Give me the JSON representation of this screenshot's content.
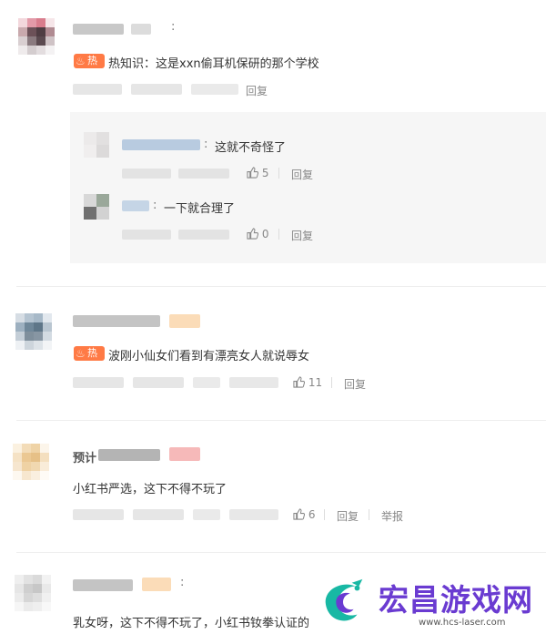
{
  "colors": {
    "hot_badge": "#ff7a45",
    "text": "#333333",
    "muted": "#888888",
    "reply_bg": "#f6f6f6",
    "brand": "#6a3bd1"
  },
  "badge_label": "热",
  "comments": [
    {
      "hot": true,
      "text": "热知识：这是xxn偷耳机保研的那个学校",
      "reply_label": "回复",
      "replies": [
        {
          "text": "这就不奇怪了",
          "likes": "5",
          "reply_label": "回复"
        },
        {
          "text": "一下就合理了",
          "likes": "0",
          "reply_label": "回复"
        }
      ]
    },
    {
      "hot": true,
      "text": "波刚小仙女们看到有漂亮女人就说辱女",
      "likes": "11",
      "reply_label": "回复"
    },
    {
      "hot": false,
      "username_fragment": "预计",
      "text": "小红书严选，这下不得不玩了",
      "likes": "6",
      "reply_label": "回复",
      "report_label": "举报"
    },
    {
      "hot": false,
      "text": "乳女呀，这下不得不玩了，小红书钕拳认证的"
    }
  ],
  "watermark": {
    "title": "宏昌游戏网",
    "url": "www.hcs-laser.com"
  }
}
